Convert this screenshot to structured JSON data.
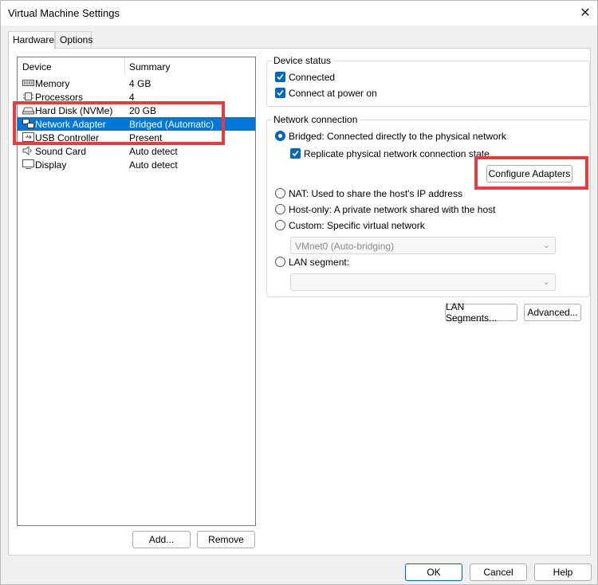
{
  "window": {
    "title": "Virtual Machine Settings",
    "close_glyph": "✕"
  },
  "tabs": [
    {
      "label": "Hardware",
      "active": true
    },
    {
      "label": "Options",
      "active": false
    }
  ],
  "device_list": {
    "headers": {
      "device": "Device",
      "summary": "Summary"
    },
    "rows": [
      {
        "icon": "memory-icon",
        "name": "Memory",
        "summary": "4 GB",
        "selected": false
      },
      {
        "icon": "processor-icon",
        "name": "Processors",
        "summary": "4",
        "selected": false
      },
      {
        "icon": "hard-disk-icon",
        "name": "Hard Disk (NVMe)",
        "summary": "20 GB",
        "selected": false
      },
      {
        "icon": "network-adapter-icon",
        "name": "Network Adapter",
        "summary": "Bridged (Automatic)",
        "selected": true
      },
      {
        "icon": "usb-icon",
        "name": "USB Controller",
        "summary": "Present",
        "selected": false
      },
      {
        "icon": "speaker-icon",
        "name": "Sound Card",
        "summary": "Auto detect",
        "selected": false
      },
      {
        "icon": "display-icon",
        "name": "Display",
        "summary": "Auto detect",
        "selected": false
      }
    ]
  },
  "list_buttons": {
    "add": "Add...",
    "remove": "Remove"
  },
  "device_status": {
    "title": "Device status",
    "connected": {
      "label": "Connected",
      "checked": true
    },
    "connect_at_power_on": {
      "label": "Connect at power on",
      "checked": true
    }
  },
  "network_connection": {
    "title": "Network connection",
    "bridged": "Bridged: Connected directly to the physical network",
    "replicate": "Replicate physical network connection state",
    "configure_adapters": "Configure Adapters",
    "nat": "NAT: Used to share the host's IP address",
    "host_only": "Host-only: A private network shared with the host",
    "custom": "Custom: Specific virtual network",
    "custom_select": "VMnet0 (Auto-bridging)",
    "lan_segment": "LAN segment:",
    "lan_select": "",
    "selected": "bridged"
  },
  "action_buttons": {
    "lan_segments": "LAN Segments...",
    "advanced": "Advanced..."
  },
  "footer": {
    "ok": "OK",
    "cancel": "Cancel",
    "help": "Help"
  },
  "colors": {
    "accent": "#0067c0",
    "selection": "#0078d7",
    "annotation": "#e83b3f"
  }
}
